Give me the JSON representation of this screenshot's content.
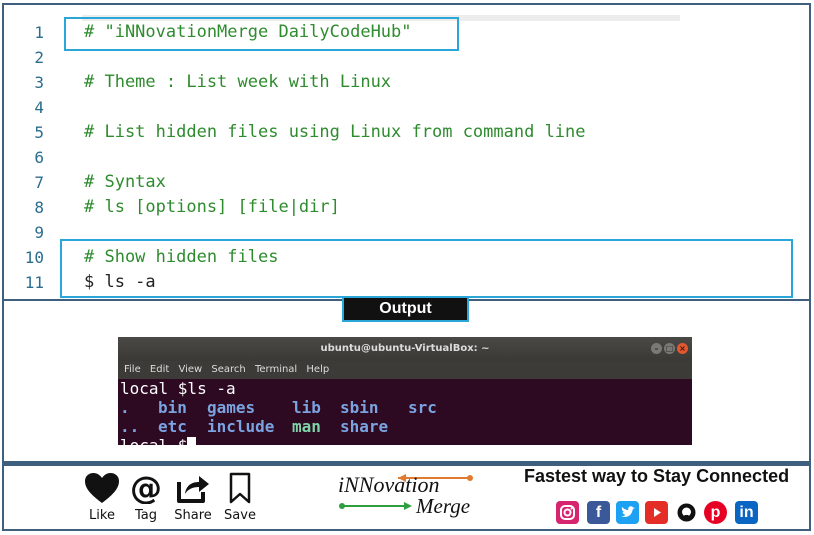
{
  "editor": {
    "lines": [
      {
        "num": "1",
        "text": "# \"iNNovationMerge DailyCodeHub\""
      },
      {
        "num": "2",
        "text": ""
      },
      {
        "num": "3",
        "text": "# Theme : List week with Linux"
      },
      {
        "num": "4",
        "text": ""
      },
      {
        "num": "5",
        "text": "# List hidden files using Linux from command line"
      },
      {
        "num": "6",
        "text": ""
      },
      {
        "num": "7",
        "text": "# Syntax"
      },
      {
        "num": "8",
        "text": "# ls [options] [file|dir]"
      },
      {
        "num": "9",
        "text": ""
      },
      {
        "num": "10",
        "text": "# Show hidden files"
      },
      {
        "num": "11",
        "text": "$ ls -a"
      }
    ]
  },
  "output": {
    "label": "Output",
    "terminal": {
      "title": "ubuntu@ubuntu-VirtualBox: ~",
      "menu": [
        "File",
        "Edit",
        "View",
        "Search",
        "Terminal",
        "Help"
      ],
      "prompt_line": "local $ls -a",
      "row1": [
        ".",
        "bin",
        "games",
        "lib",
        "sbin",
        "src"
      ],
      "row2": [
        "..",
        "etc",
        "include",
        "man",
        "share"
      ],
      "row3": "local $"
    }
  },
  "footer": {
    "actions": [
      {
        "label": "Like",
        "icon": "heart-icon"
      },
      {
        "label": "Tag",
        "icon": "at-icon"
      },
      {
        "label": "Share",
        "icon": "share-icon"
      },
      {
        "label": "Save",
        "icon": "bookmark-icon"
      }
    ],
    "logo": {
      "top": "iNNovation",
      "bottom": "Merge"
    },
    "connect_title": "Fastest way to Stay Connected",
    "social": [
      {
        "name": "instagram-icon",
        "color": "#d6246e"
      },
      {
        "name": "facebook-icon",
        "color": "#3b5998"
      },
      {
        "name": "twitter-icon",
        "color": "#1da1f2"
      },
      {
        "name": "youtube-icon",
        "color": "#e52d27"
      },
      {
        "name": "github-icon",
        "color": "#111111"
      },
      {
        "name": "pinterest-icon",
        "color": "#e60023"
      },
      {
        "name": "linkedin-icon",
        "color": "#0a66c2"
      }
    ]
  }
}
